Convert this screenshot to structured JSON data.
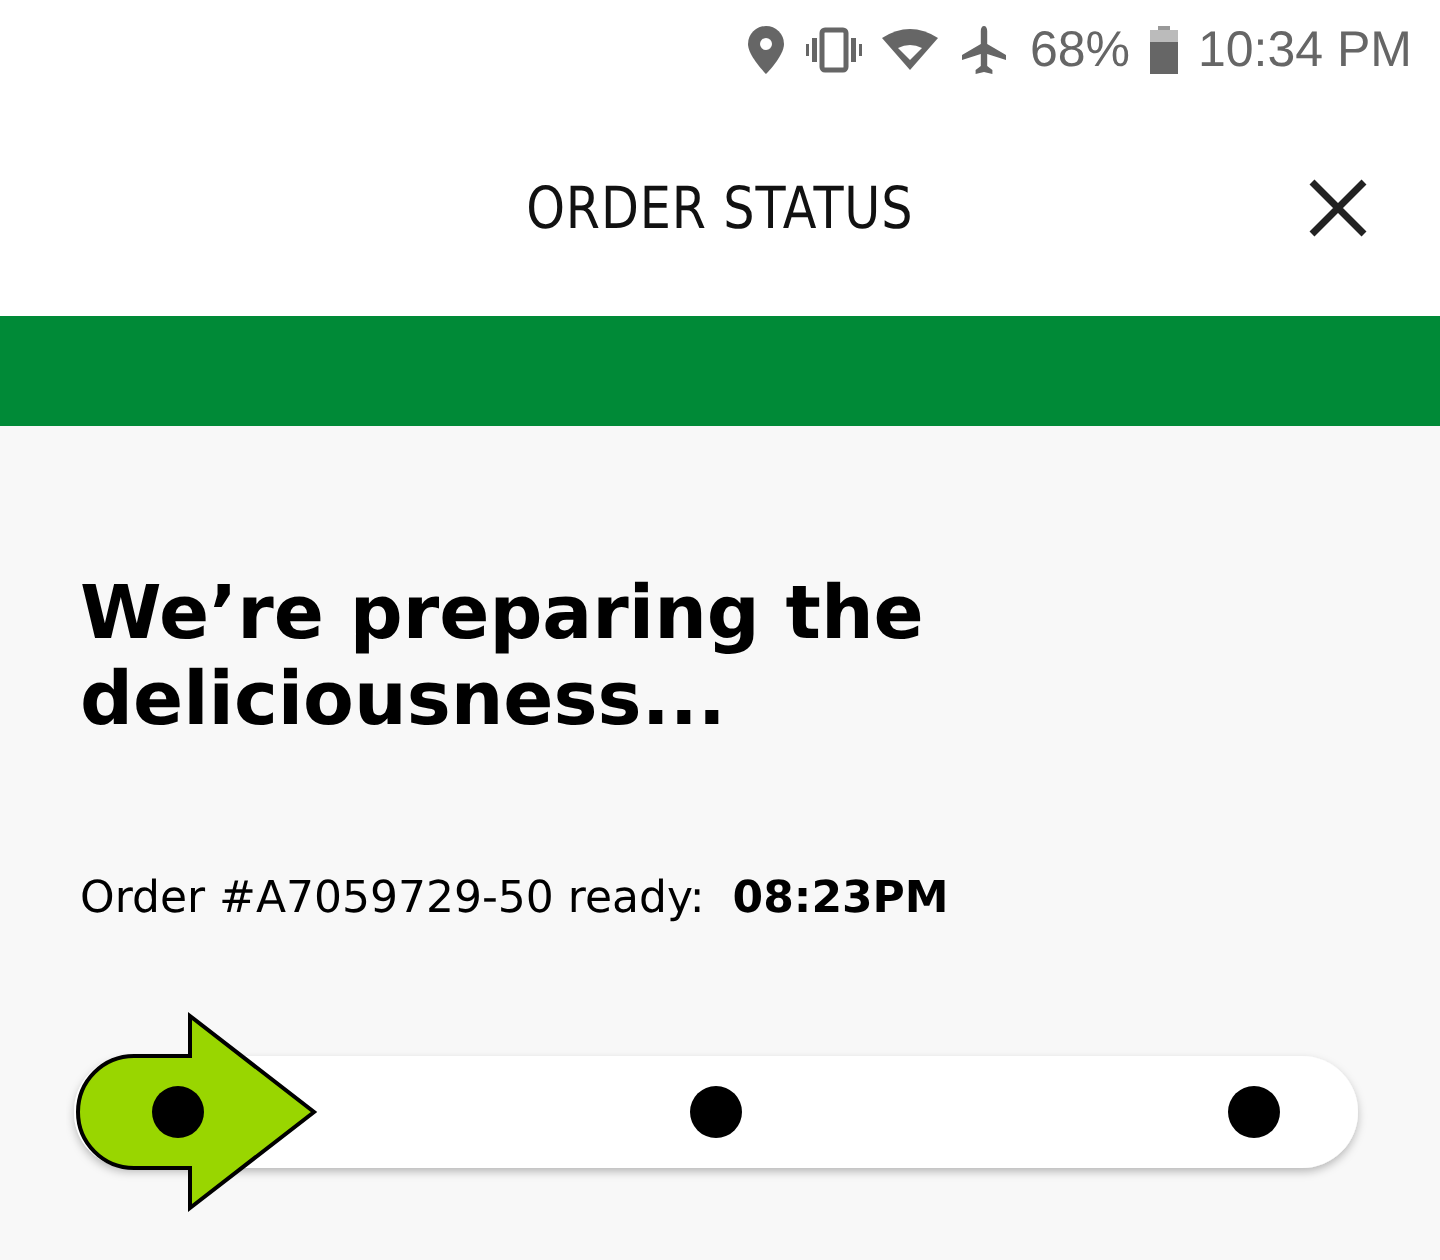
{
  "status_bar": {
    "battery": "68%",
    "time": "10:34 PM"
  },
  "header": {
    "title": "ORDER STATUS"
  },
  "heading": "We’re preparing the deliciousness...",
  "order_line": {
    "label": "Order #A7059729-50 ready:",
    "time": "08:23PM"
  },
  "steps": [
    {
      "selected": true
    },
    {
      "selected": false
    },
    {
      "selected": false
    }
  ]
}
